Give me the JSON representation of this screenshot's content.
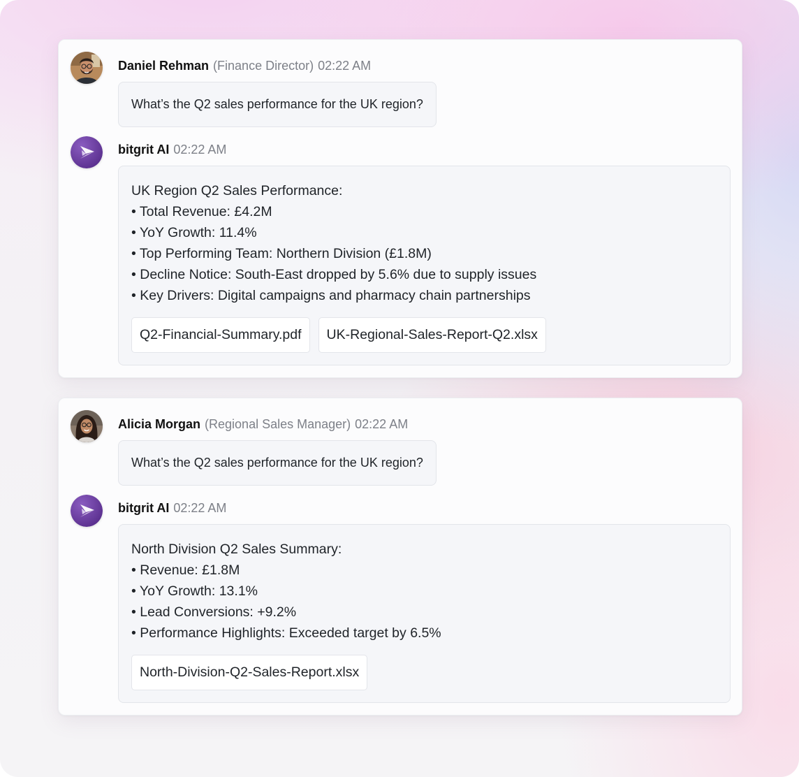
{
  "threads": [
    {
      "user": {
        "name": "Daniel Rehman",
        "role": "(Finance Director)",
        "time": "02:22 AM",
        "avatar_icon": "user-avatar-man"
      },
      "question": "What’s the Q2 sales performance for the UK region?",
      "ai": {
        "name": "bitgrit AI",
        "time": "02:22 AM",
        "avatar_icon": "bitgrit-logo-icon"
      },
      "answer_lines": [
        "UK Region Q2 Sales Performance:",
        "• Total Revenue: £4.2M",
        "• YoY Growth: 11.4%",
        "• Top Performing Team: Northern Division (£1.8M)",
        "• Decline Notice: South-East dropped by 5.6% due to supply issues",
        "• Key Drivers: Digital campaigns and pharmacy chain partnerships"
      ],
      "attachments": [
        "Q2-Financial-Summary.pdf",
        "UK-Regional-Sales-Report-Q2.xlsx"
      ]
    },
    {
      "user": {
        "name": "Alicia Morgan",
        "role": "(Regional Sales Manager)",
        "time": "02:22 AM",
        "avatar_icon": "user-avatar-woman"
      },
      "question": "What’s the Q2 sales performance for the UK region?",
      "ai": {
        "name": "bitgrit AI",
        "time": "02:22 AM",
        "avatar_icon": "bitgrit-logo-icon"
      },
      "answer_lines": [
        "North Division Q2 Sales Summary:",
        "• Revenue: £1.8M",
        "• YoY Growth: 13.1%",
        "• Lead Conversions: +9.2%",
        "• Performance Highlights: Exceeded target by 6.5%"
      ],
      "attachments": [
        "North-Division-Q2-Sales-Report.xlsx"
      ]
    }
  ],
  "colors": {
    "brand_purple": "#6b3fa0",
    "muted_text": "#7d8088",
    "bubble_bg": "#f5f6f9"
  }
}
